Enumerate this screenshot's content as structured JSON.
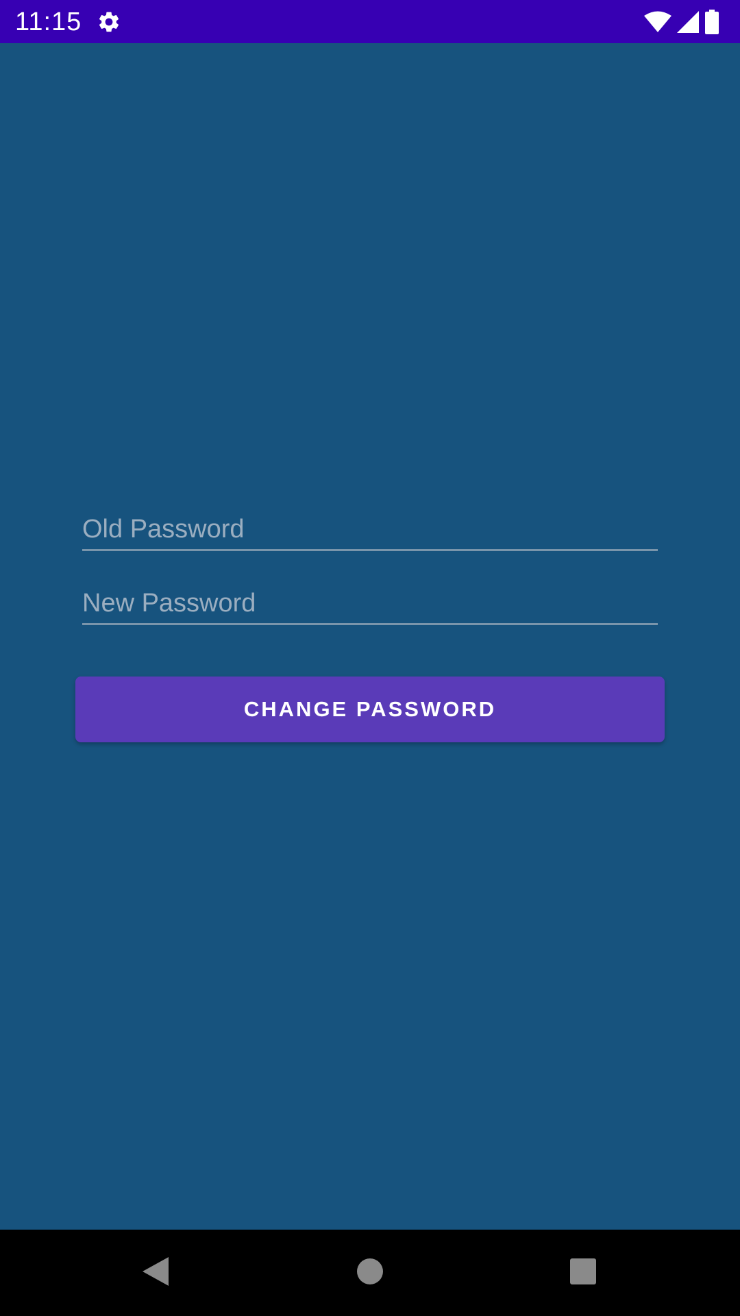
{
  "status_bar": {
    "time": "11:15",
    "icons": [
      "gear-icon",
      "wifi-icon",
      "signal-icon",
      "battery-icon"
    ]
  },
  "form": {
    "old_password": {
      "placeholder": "Old Password",
      "value": ""
    },
    "new_password": {
      "placeholder": "New Password",
      "value": ""
    },
    "submit_label": "CHANGE PASSWORD"
  },
  "nav_bar": {
    "icons": [
      "back-icon",
      "home-icon",
      "recents-icon"
    ]
  },
  "colors": {
    "status_bar": "#3700B3",
    "background": "#17537E",
    "button": "#5A3BB8",
    "nav_bar": "#000000"
  }
}
